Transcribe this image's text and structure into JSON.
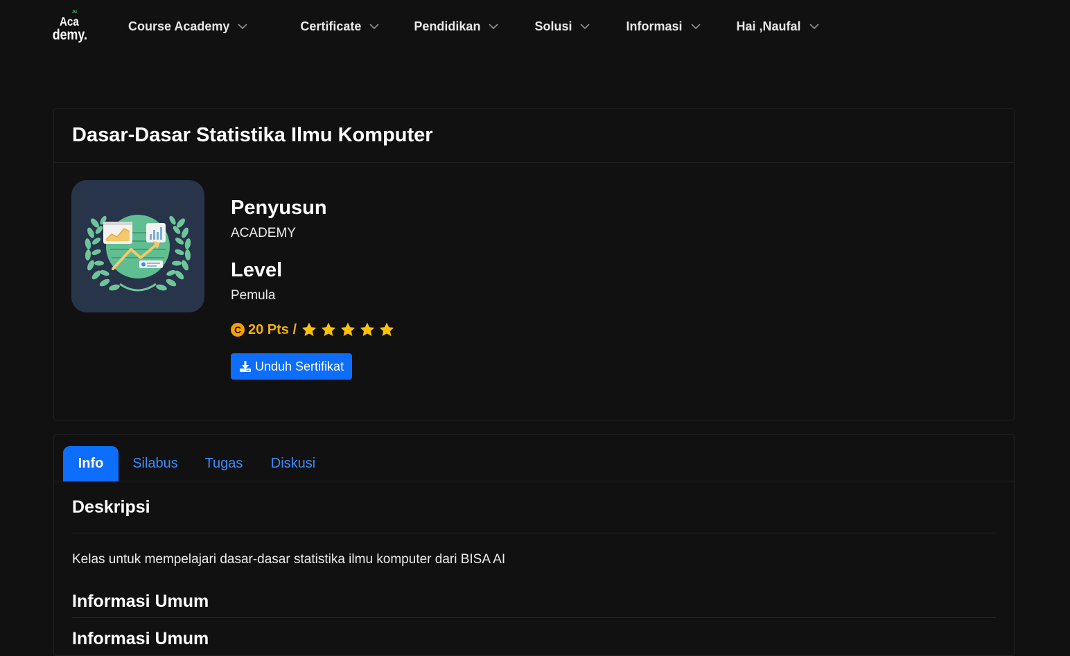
{
  "nav": {
    "logo_text_top": "Aca",
    "logo_text_bottom": "demy.",
    "logo_text_ai": "AI",
    "items": [
      {
        "label": "Course Academy"
      },
      {
        "label": "Certificate"
      },
      {
        "label": "Pendidikan"
      },
      {
        "label": "Solusi"
      },
      {
        "label": "Informasi"
      },
      {
        "label": "Hai ,Naufal"
      }
    ]
  },
  "course": {
    "title": "Dasar-Dasar Statistika Ilmu Komputer",
    "author_heading": "Penyusun",
    "author": "ACADEMY",
    "level_heading": "Level",
    "level": "Pemula",
    "coin_symbol": "C",
    "points": "20 Pts /",
    "rating": 5,
    "rating_max": 5,
    "download_button": "Unduh Sertifikat"
  },
  "tabs": [
    {
      "label": "Info",
      "active": true
    },
    {
      "label": "Silabus",
      "active": false
    },
    {
      "label": "Tugas",
      "active": false
    },
    {
      "label": "Diskusi",
      "active": false
    }
  ],
  "info": {
    "description_heading": "Deskripsi",
    "description": "Kelas untuk mempelajari dasar-dasar statistika ilmu komputer dari BISA AI",
    "general_heading": "Informasi Umum",
    "next_heading": "Informasi Umum"
  },
  "colors": {
    "background": "#111111",
    "primary": "#0d6efd",
    "link": "#3d8bfd",
    "points": "#f5b100",
    "star": "#ffc107",
    "thumb_bg": "#27344a"
  }
}
